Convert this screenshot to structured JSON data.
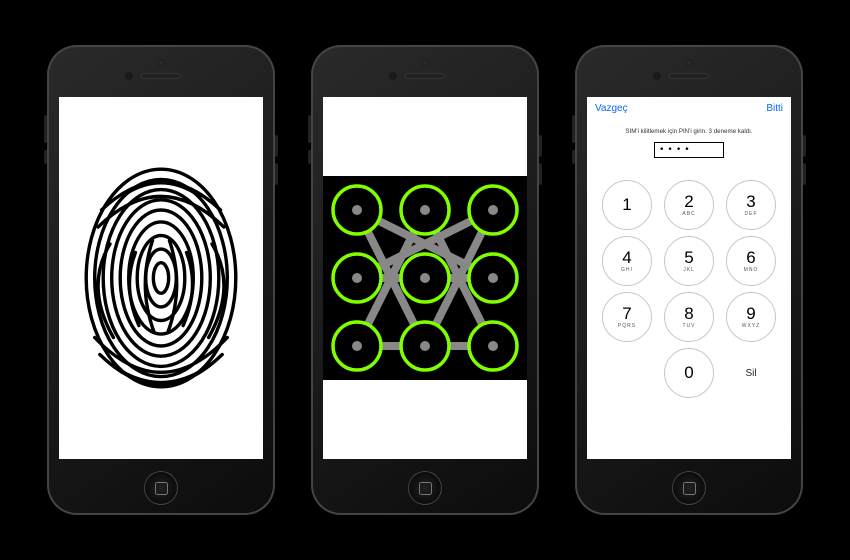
{
  "pin": {
    "cancel": "Vazgeç",
    "done": "Bitti",
    "message": "SIM'i kilitlemek için PIN'i girin. 3 deneme kaldı.",
    "entered": "••••",
    "delete_label": "Sil",
    "keys": {
      "k1": {
        "n": "1",
        "l": ""
      },
      "k2": {
        "n": "2",
        "l": "ABC"
      },
      "k3": {
        "n": "3",
        "l": "DEF"
      },
      "k4": {
        "n": "4",
        "l": "GHI"
      },
      "k5": {
        "n": "5",
        "l": "JKL"
      },
      "k6": {
        "n": "6",
        "l": "MNO"
      },
      "k7": {
        "n": "7",
        "l": "PQRS"
      },
      "k8": {
        "n": "8",
        "l": "TUV"
      },
      "k9": {
        "n": "9",
        "l": "WXYZ"
      },
      "k0": {
        "n": "0",
        "l": ""
      }
    }
  },
  "pattern": {
    "dot_color": "#7fff00",
    "line_color": "#8a8a8a"
  }
}
